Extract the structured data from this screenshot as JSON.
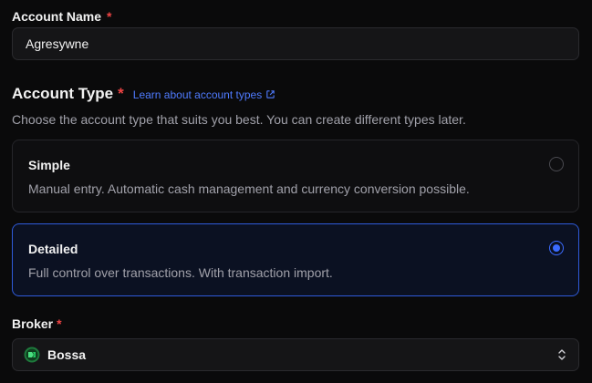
{
  "account_name": {
    "label": "Account Name",
    "required_mark": "*",
    "value": "Agresywne"
  },
  "account_type": {
    "title": "Account Type",
    "required_mark": "*",
    "learn_link": "Learn about account types",
    "description": "Choose the account type that suits you best. You can create different types later.",
    "options": [
      {
        "title": "Simple",
        "description": "Manual entry. Automatic cash management and currency conversion possible.",
        "selected": false
      },
      {
        "title": "Detailed",
        "description": "Full control over transactions. With transaction import.",
        "selected": true
      }
    ]
  },
  "broker": {
    "label": "Broker",
    "required_mark": "*",
    "selected": "Bossa",
    "icon": "bossa-logo-icon"
  },
  "colors": {
    "accent": "#3b6bff",
    "required": "#ef4444",
    "link": "#4f7bff",
    "background": "#0a0a0b"
  }
}
